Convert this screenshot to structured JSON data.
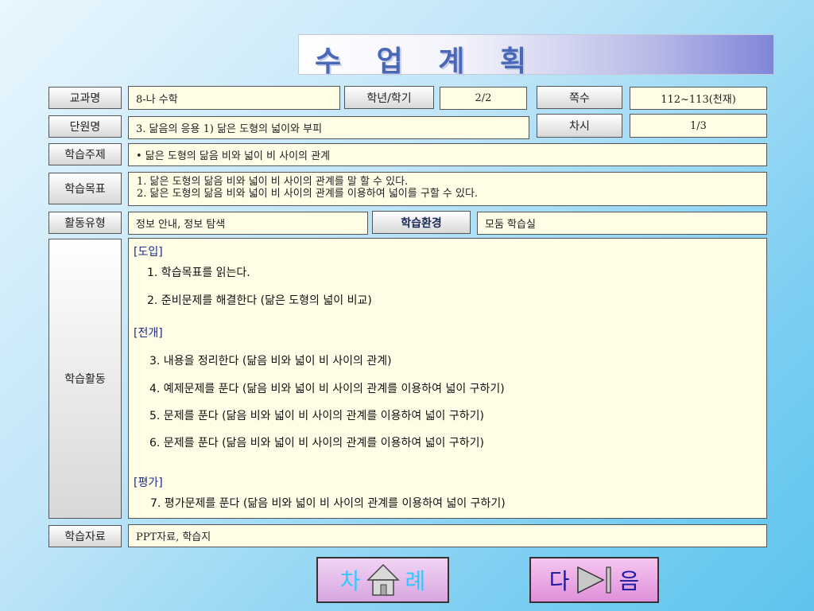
{
  "title": "수 업 계 획",
  "row1": {
    "subject_label": "교과명",
    "subject_value": "8-나  수학",
    "grade_label": "학년/학기",
    "grade_value": "2/2",
    "pages_label": "쪽수",
    "pages_value": "112~113(천재)"
  },
  "row2": {
    "unit_label": "단원명",
    "unit_value": "3. 닮음의 응용        1) 닮은 도형의 넓이와 부피",
    "period_label": "차시",
    "period_value": "1/3"
  },
  "row3": {
    "topic_label": "학습주제",
    "topic_value": "• 닮은 도형의 닮음 비와 넓이 비 사이의 관계"
  },
  "row4": {
    "objectives_label": "학습목표",
    "objectives": [
      "1. 닮은 도형의 닮음 비와 넓이 비 사이의 관계를 말 할 수 있다.",
      "2. 닮은 도형의 닮음 비와 넓이 비 사이의 관계를 이용하여 넓이를 구할 수 있다."
    ]
  },
  "row5": {
    "activity_type_label": "활동유형",
    "activity_type_value": "정보 안내, 정보 탐색",
    "env_label": "학습환경",
    "env_value": "모둠 학습실"
  },
  "activities": {
    "label": "학습활동",
    "intro_head": "[도입]",
    "intro": [
      "1. 학습목표를 읽는다.",
      "2. 준비문제를 해결한다 (닮은 도형의 넓이 비교)"
    ],
    "dev_head": "[전개]",
    "dev": [
      "3. 내용을 정리한다 (닮음 비와 넓이 비 사이의 관계)",
      "4. 예제문제를 푼다 (닮음 비와 넓이 비 사이의 관계를 이용하여 넓이 구하기)",
      "5. 문제를 푼다 (닮음 비와 넓이 비 사이의 관계를 이용하여 넓이 구하기)",
      "6. 문제를 푼다 (닮음 비와 넓이 비 사이의 관계를 이용하여 넓이 구하기)"
    ],
    "eval_head": "[평가]",
    "eval": [
      "7. 평가문제를 푼다 (닮음 비와 넓이 비 사이의 관계를 이용하여 넓이 구하기)"
    ]
  },
  "materials": {
    "label": "학습자료",
    "value": "PPT자료, 학습지"
  },
  "nav": {
    "toc_left": "차",
    "toc_right": "례",
    "next_left": "다",
    "next_right": "음"
  }
}
